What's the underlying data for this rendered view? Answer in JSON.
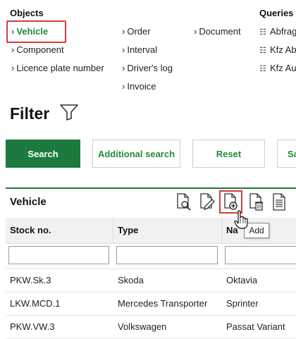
{
  "objects": {
    "title": "Objects",
    "col1": [
      {
        "label": "Vehicle",
        "active": true
      },
      {
        "label": "Component"
      },
      {
        "label": "Licence plate number"
      }
    ],
    "col2": [
      {
        "label": "Order"
      },
      {
        "label": "Interval"
      },
      {
        "label": "Driver's log"
      },
      {
        "label": "Invoice"
      }
    ],
    "col3": [
      {
        "label": "Document"
      }
    ]
  },
  "queries": {
    "title": "Queries",
    "items": [
      {
        "label": "Abfrag",
        "icon": "query-icon"
      },
      {
        "label": "Kfz Abt",
        "icon": "query-icon"
      },
      {
        "label": "Kfz Aus",
        "icon": "query-icon"
      }
    ]
  },
  "filter": {
    "title": "Filter",
    "icon": "funnel-icon",
    "buttons": {
      "search": "Search",
      "additional": "Additional search",
      "reset": "Reset",
      "save": "Sa"
    }
  },
  "panel": {
    "title": "Vehicle",
    "tools": [
      "view-document-icon",
      "edit-document-icon",
      "add-document-icon",
      "delete-document-icon",
      "list-document-icon"
    ],
    "tooltip": "Add"
  },
  "table": {
    "columns": [
      "Stock no.",
      "Type",
      "Na"
    ],
    "filter_values": [
      "",
      "",
      ""
    ],
    "rows": [
      [
        "PKW.Sk.3",
        "Skoda",
        "Oktavia"
      ],
      [
        "LKW.MCD.1",
        "Mercedes Transporter",
        "Sprinter"
      ],
      [
        "PKW.VW.3",
        "Volkswagen",
        "Passat Variant"
      ]
    ]
  },
  "colors": {
    "accent": "#1d7a3e",
    "link_active": "#1f8a3c",
    "highlight": "#d63b3b"
  }
}
